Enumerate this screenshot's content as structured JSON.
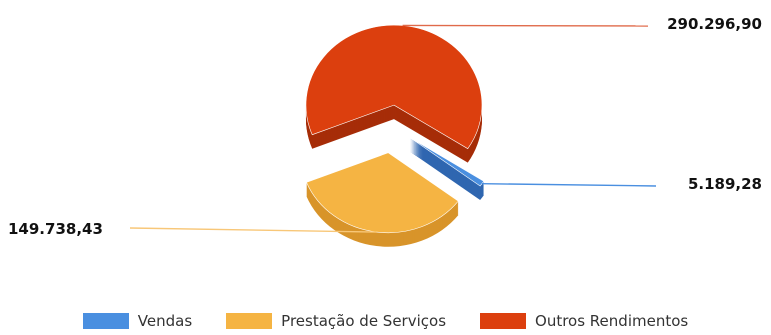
{
  "chart_data": {
    "type": "pie",
    "style": "3d-exploded",
    "series": [
      {
        "name": "Vendas",
        "value": 5189.28,
        "label": "5.189,28",
        "color": "#4a8fe0",
        "side_color": "#2f66b0",
        "leader_color": "#4a8fe0"
      },
      {
        "name": "Prestação de Serviços",
        "value": 149738.43,
        "label": "149.738,43",
        "color": "#f5b443",
        "side_color": "#d8942a",
        "leader_color": "#f8c778"
      },
      {
        "name": "Outros Rendimentos",
        "value": 290296.9,
        "label": "290.296,90",
        "color": "#dc3f0e",
        "side_color": "#a62d08",
        "leader_color": "#e06a4a"
      }
    ],
    "legend_position": "bottom"
  },
  "legend": {
    "items": [
      {
        "label": "Vendas",
        "color": "#4a8fe0"
      },
      {
        "label": "Prestação de Serviços",
        "color": "#f5b443"
      },
      {
        "label": "Outros Rendimentos",
        "color": "#dc3f0e"
      }
    ]
  }
}
